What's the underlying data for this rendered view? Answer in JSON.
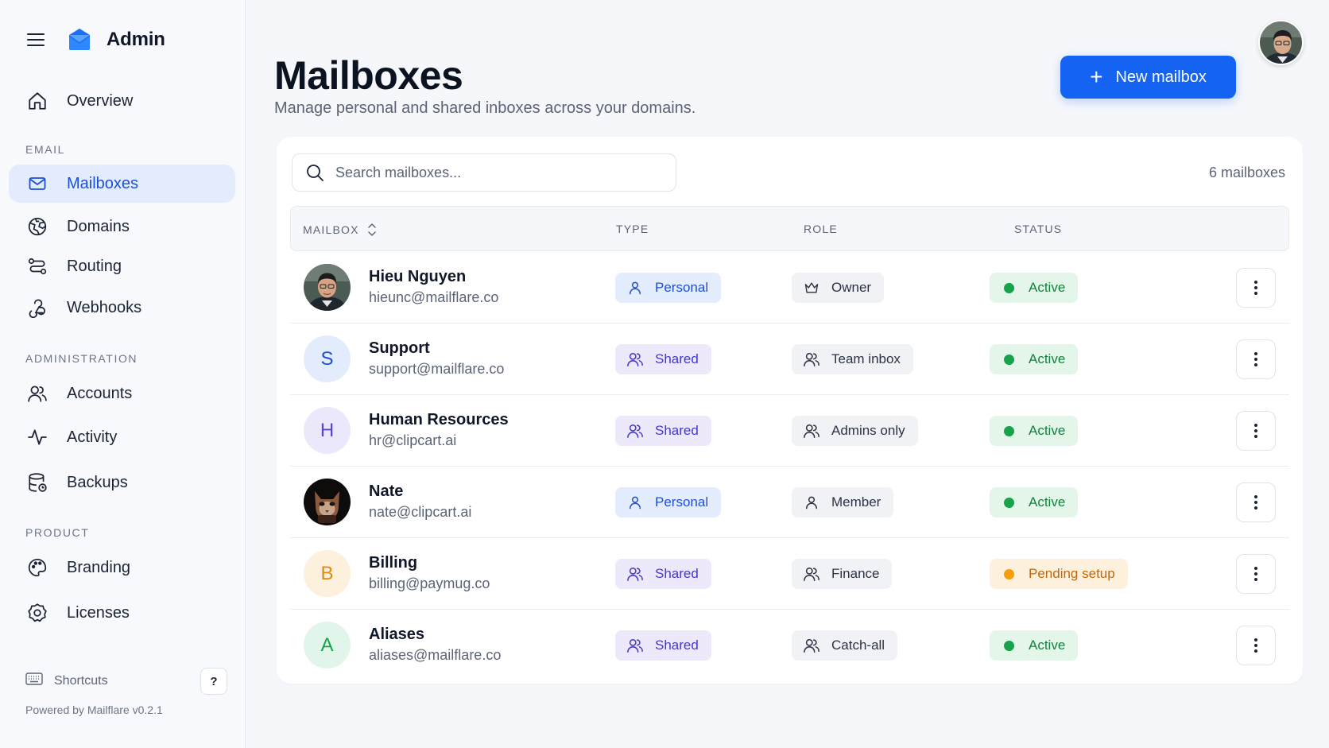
{
  "app": {
    "title": "Admin"
  },
  "sidebar": {
    "items": [
      {
        "label": "Overview",
        "icon": "home-icon"
      },
      {
        "label": "Mailboxes",
        "icon": "mail-icon",
        "active": true
      },
      {
        "label": "Domains",
        "icon": "globe-icon"
      },
      {
        "label": "Routing",
        "icon": "route-icon"
      },
      {
        "label": "Webhooks",
        "icon": "webhook-icon"
      },
      {
        "label": "Accounts",
        "icon": "users-icon"
      },
      {
        "label": "Activity",
        "icon": "activity-icon"
      },
      {
        "label": "Backups",
        "icon": "database-icon"
      },
      {
        "label": "Branding",
        "icon": "palette-icon"
      },
      {
        "label": "Licenses",
        "icon": "badge-icon"
      }
    ],
    "sections": {
      "email": "EMAIL",
      "administration": "ADMINISTRATION",
      "product": "PRODUCT"
    },
    "shortcuts_label": "Shortcuts",
    "help_label": "?",
    "powered_by": "Powered by Mailflare v0.2.1"
  },
  "header": {
    "title": "Mailboxes",
    "subtitle": "Manage personal and shared inboxes across your domains.",
    "new_button": "New mailbox"
  },
  "toolbar": {
    "search_placeholder": "Search mailboxes...",
    "count": "6 mailboxes"
  },
  "table": {
    "columns": [
      "MAILBOX",
      "TYPE",
      "ROLE",
      "STATUS"
    ],
    "rows": [
      {
        "name": "Hieu Nguyen",
        "email": "hieunc@mailflare.co",
        "initial": "",
        "type": "Personal",
        "role": "Owner",
        "status": "Active"
      },
      {
        "name": "Support",
        "email": "support@mailflare.co",
        "initial": "S",
        "type": "Shared",
        "role": "Team inbox",
        "status": "Active"
      },
      {
        "name": "Human Resources",
        "email": "hr@clipcart.ai",
        "initial": "H",
        "type": "Shared",
        "role": "Admins only",
        "status": "Active"
      },
      {
        "name": "Nate",
        "email": "nate@clipcart.ai",
        "initial": "",
        "type": "Personal",
        "role": "Member",
        "status": "Active"
      },
      {
        "name": "Billing",
        "email": "billing@paymug.co",
        "initial": "B",
        "type": "Shared",
        "role": "Finance",
        "status": "Pending setup"
      },
      {
        "name": "Aliases",
        "email": "aliases@mailflare.co",
        "initial": "A",
        "type": "Shared",
        "role": "Catch-all",
        "status": "Active"
      }
    ]
  },
  "colors": {
    "accent": "#1463f3",
    "active_status": "#16a34a",
    "pending_status": "#f59e0b"
  }
}
